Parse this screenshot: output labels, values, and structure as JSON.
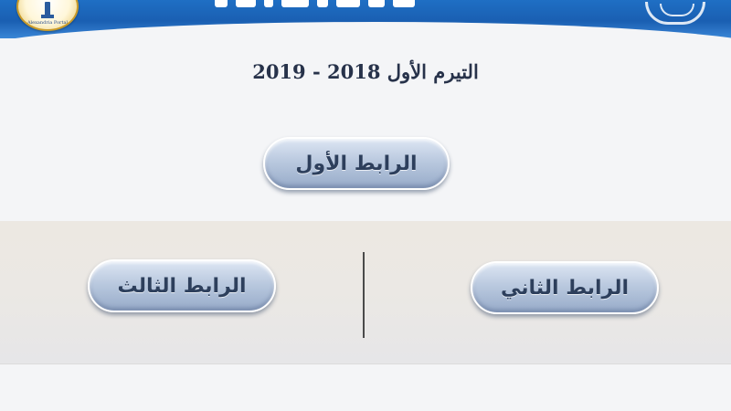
{
  "header": {
    "logo_caption": "Alexandria Portal",
    "colors": {
      "banner": "#1f6fc4",
      "badge_border": "#c99b2a"
    }
  },
  "main": {
    "term_title": "التيرم الأول 2018 - 2019",
    "links": {
      "first": "الرابط الأول",
      "second": "الرابط الثاني",
      "third": "الرابط الثالث"
    }
  },
  "colors": {
    "button_text": "#2d3f5c",
    "title_text": "#27324a",
    "background": "#f4f5f7"
  }
}
